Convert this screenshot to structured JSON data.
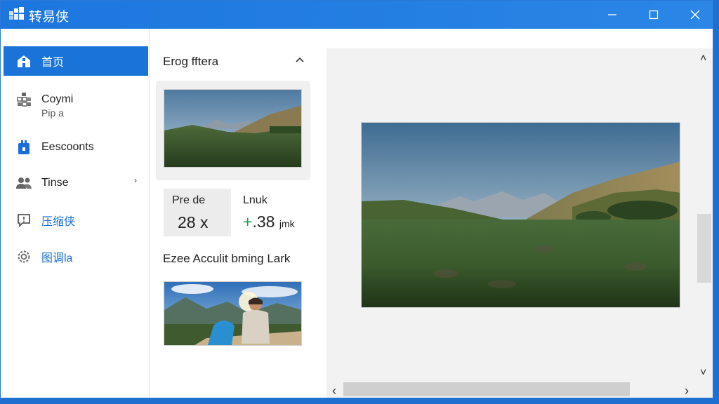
{
  "window": {
    "title": "转易侠",
    "accent": "#1e7be0",
    "controls": [
      "minimize-icon",
      "maximize-icon",
      "close-icon"
    ]
  },
  "sidebar": {
    "items": [
      {
        "label": "首页",
        "icon": "home-icon",
        "active": true
      },
      {
        "label": "Coymi",
        "sub": "Pip a",
        "icon": "grid-icon"
      },
      {
        "label": "Eescoonts",
        "icon": "briefcase-icon"
      },
      {
        "label": "Tinse",
        "icon": "people-icon",
        "chevron": "›"
      },
      {
        "label": "压缩侠",
        "icon": "chat-icon"
      },
      {
        "label": "图调la",
        "icon": "gear-icon"
      }
    ]
  },
  "panel": {
    "section_title": "Erog fftera",
    "stat": {
      "label": "Pre de",
      "value": "28 x"
    },
    "link": {
      "label": "Lnuk",
      "prefix": "+",
      "value": ".38",
      "unit": "jmk"
    },
    "caption": "Ezee Acculit bming Lark"
  },
  "viewer": {
    "scroll_up": "˄",
    "scroll_down": "˅",
    "scroll_left": "‹",
    "scroll_right": "›"
  }
}
